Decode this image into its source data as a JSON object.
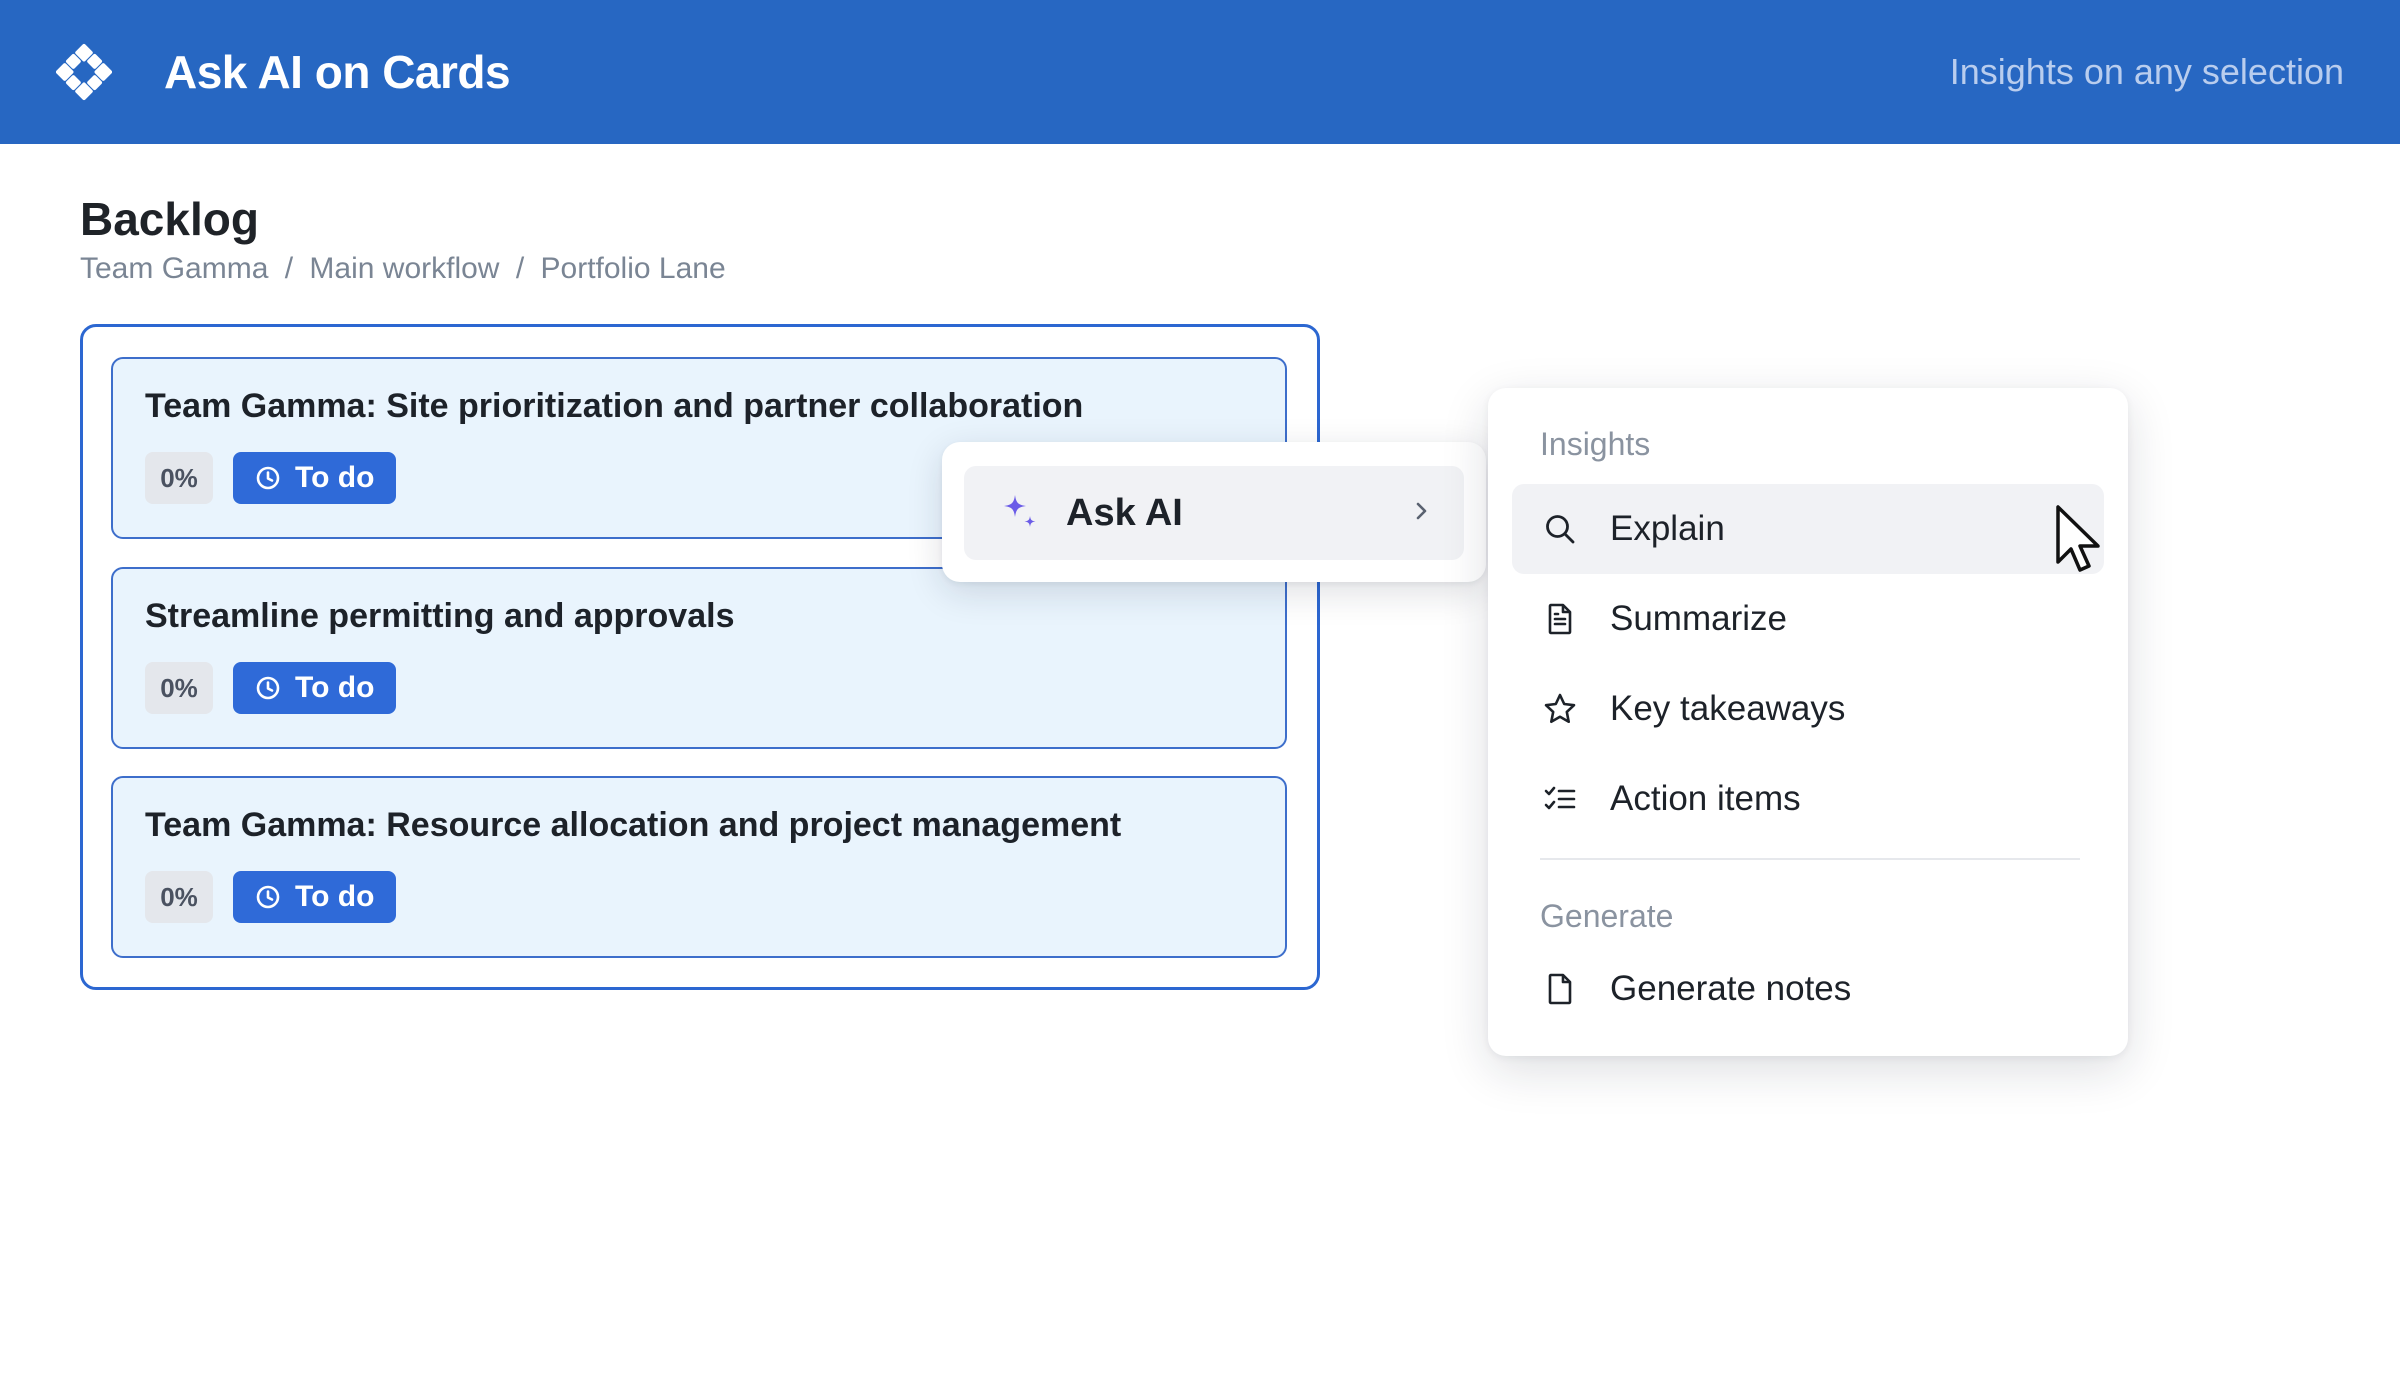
{
  "header": {
    "app_title": "Ask AI on Cards",
    "tagline": "Insights on any selection",
    "logo_icon": "diamond-grid-logo-icon",
    "background_color": "#2767c2"
  },
  "board": {
    "title": "Backlog",
    "breadcrumb": [
      "Team Gamma",
      "Main workflow",
      "Portfolio Lane"
    ],
    "breadcrumb_separator": "/"
  },
  "cards": [
    {
      "title": "Team Gamma: Site prioritization and partner collaboration",
      "progress": "0%",
      "status": "To do",
      "status_icon": "clock-icon"
    },
    {
      "title": "Streamline permitting and approvals",
      "progress": "0%",
      "status": "To do",
      "status_icon": "clock-icon"
    },
    {
      "title": "Team Gamma: Resource allocation and project management",
      "progress": "0%",
      "status": "To do",
      "status_icon": "clock-icon"
    }
  ],
  "context_menu": {
    "ask_ai_label": "Ask AI",
    "ask_ai_icon": "sparkle-icon",
    "chevron_icon": "chevron-right-icon"
  },
  "submenu": {
    "insights_label": "Insights",
    "insights_items": [
      {
        "label": "Explain",
        "icon": "search-icon",
        "active": true
      },
      {
        "label": "Summarize",
        "icon": "document-icon",
        "active": false
      },
      {
        "label": "Key takeaways",
        "icon": "star-icon",
        "active": false
      },
      {
        "label": "Action items",
        "icon": "checklist-icon",
        "active": false
      }
    ],
    "generate_label": "Generate",
    "generate_items": [
      {
        "label": "Generate notes",
        "icon": "file-icon",
        "active": false
      }
    ]
  },
  "colors": {
    "accent": "#2f6ad8",
    "lane_border": "#2c67d1",
    "card_background": "#e9f4fd",
    "sparkle": "#6b5ce7"
  }
}
